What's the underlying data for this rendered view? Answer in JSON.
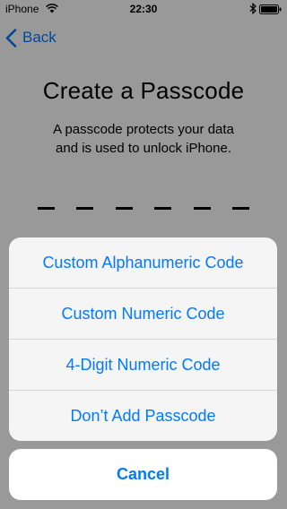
{
  "status_bar": {
    "carrier": "iPhone",
    "time": "22:30",
    "icons": [
      "wifi-icon",
      "bluetooth-icon",
      "battery-icon"
    ]
  },
  "nav": {
    "back_label": "Back",
    "back_icon": "chevron-left-icon"
  },
  "title": "Create a Passcode",
  "subtitle_line1": "A passcode protects your data",
  "subtitle_line2": "and is used to unlock iPhone.",
  "passcode_length_indicators": 6,
  "action_sheet": {
    "options": [
      "Custom Alphanumeric Code",
      "Custom Numeric Code",
      "4-Digit Numeric Code",
      "Don’t Add Passcode"
    ],
    "cancel_label": "Cancel"
  },
  "colors": {
    "accent": "#007aff",
    "dim_overlay": "rgba(0,0,0,0.4)"
  }
}
